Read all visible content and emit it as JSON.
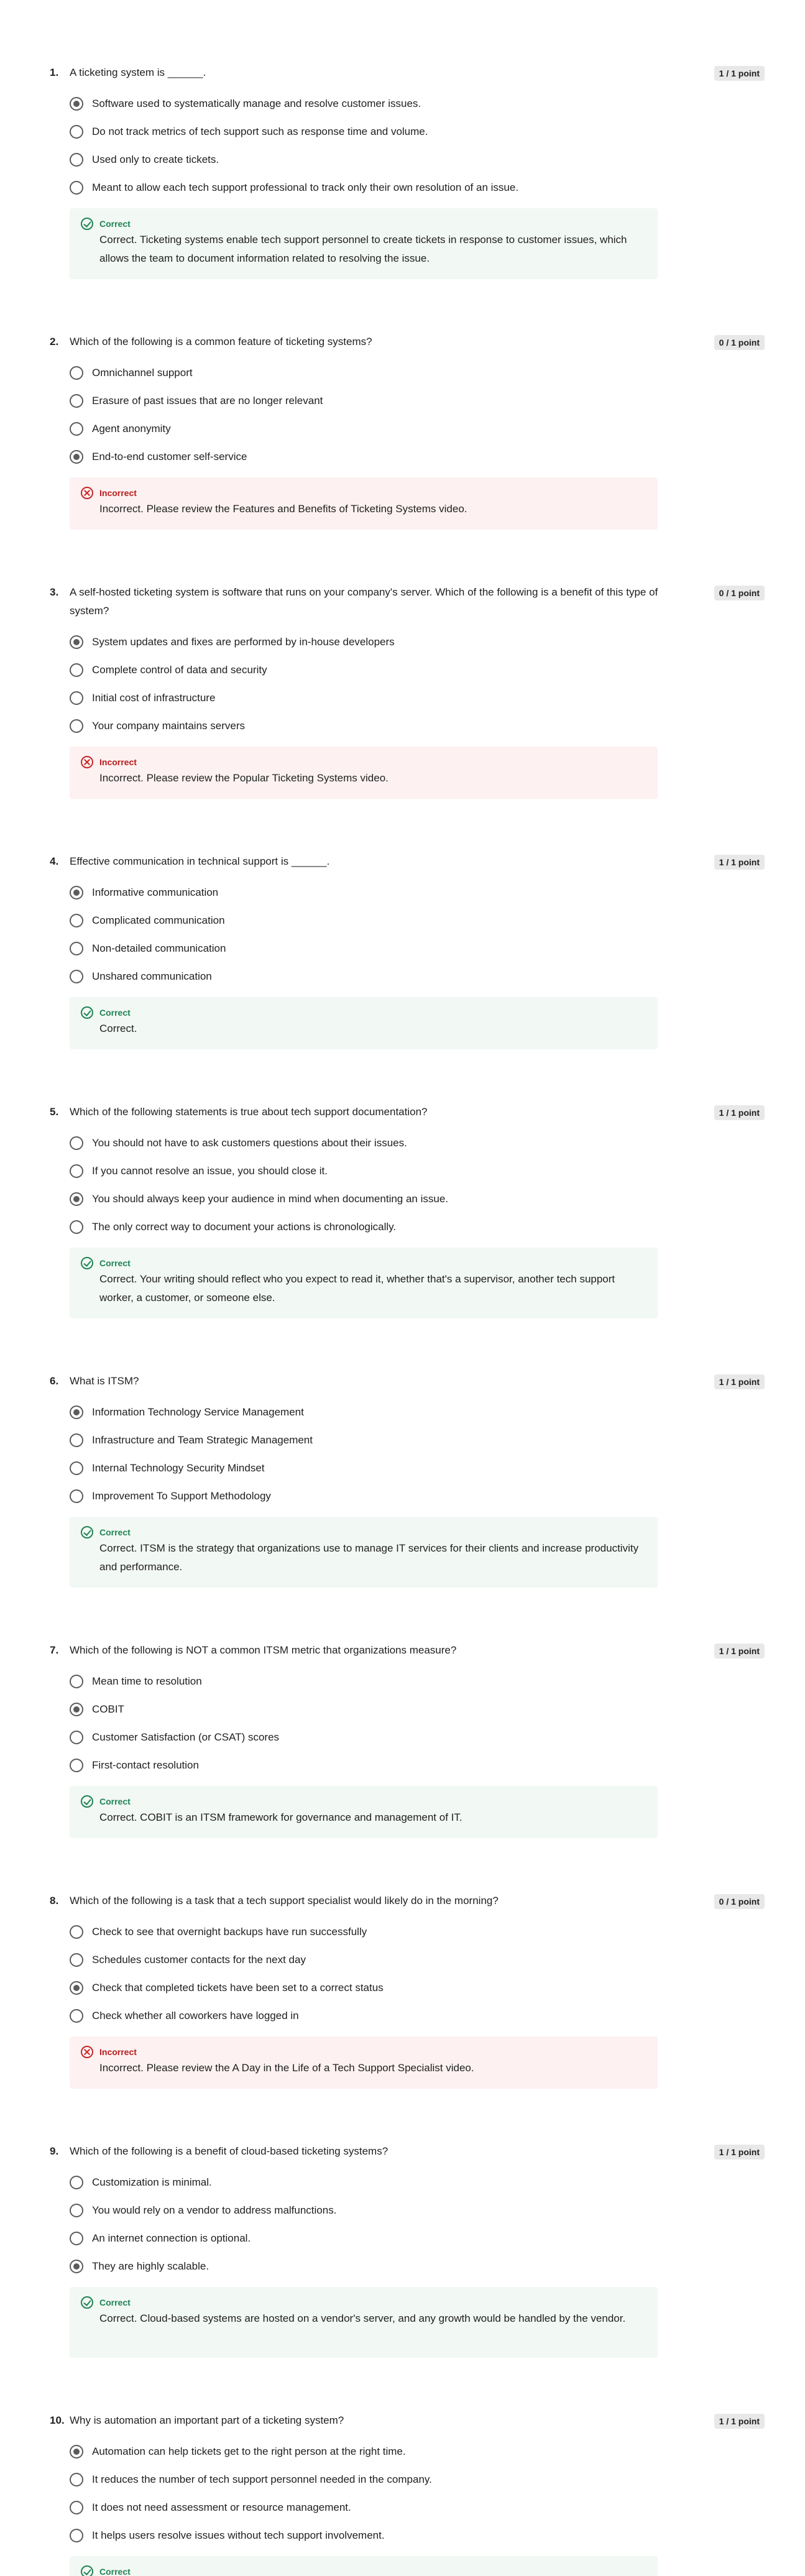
{
  "questions": [
    {
      "number": "1.",
      "text": "A ticketing system is ______.",
      "points": "1 / 1 point",
      "options": [
        "Software used to systematically manage and resolve customer issues.",
        "Do not track metrics of tech support such as response time and volume.",
        "Used only to create tickets.",
        "Meant to allow each tech support professional to track only their own resolution of an issue."
      ],
      "selected": 0,
      "status": "correct",
      "feedback_title": "Correct",
      "feedback_text": "Correct. Ticketing systems enable tech support personnel to create tickets in response to customer issues, which allows the team to document information related to resolving the issue."
    },
    {
      "number": "2.",
      "text": "Which of the following is a common feature of ticketing systems?",
      "points": "0 / 1 point",
      "options": [
        "Omnichannel support",
        "Erasure of past issues that are no longer relevant",
        "Agent anonymity",
        "End-to-end customer self-service"
      ],
      "selected": 3,
      "status": "incorrect",
      "feedback_title": "Incorrect",
      "feedback_text": "Incorrect. Please review the Features and Benefits of Ticketing Systems video."
    },
    {
      "number": "3.",
      "text": "A self-hosted ticketing system is software that runs on your company's server. Which of the following is a benefit of this type of system?",
      "points": "0 / 1 point",
      "options": [
        "System updates and fixes are performed by in-house developers",
        "Complete control of data and security",
        "Initial cost of infrastructure",
        "Your company maintains servers"
      ],
      "selected": 0,
      "status": "incorrect",
      "feedback_title": "Incorrect",
      "feedback_text": "Incorrect. Please review the Popular Ticketing Systems video."
    },
    {
      "number": "4.",
      "text": "Effective communication in technical support is ______.",
      "points": "1 / 1 point",
      "options": [
        "Informative communication",
        "Complicated communication",
        "Non-detailed communication",
        "Unshared communication"
      ],
      "selected": 0,
      "status": "correct",
      "feedback_title": "Correct",
      "feedback_text": "Correct."
    },
    {
      "number": "5.",
      "text": "Which of the following statements is true about tech support documentation?",
      "points": "1 / 1 point",
      "options": [
        "You should not have to ask customers questions about their issues.",
        "If you cannot resolve an issue, you should close it.",
        "You should always keep your audience in mind when documenting an issue.",
        "The only correct way to document your actions is chronologically."
      ],
      "selected": 2,
      "status": "correct",
      "feedback_title": "Correct",
      "feedback_text": "Correct. Your writing should reflect who you expect to read it, whether that's a supervisor, another tech support worker, a customer, or someone else."
    },
    {
      "number": "6.",
      "text": "What is ITSM?",
      "points": "1 / 1 point",
      "options": [
        "Information Technology Service Management",
        "Infrastructure and Team Strategic Management",
        "Internal Technology Security Mindset",
        "Improvement To Support Methodology"
      ],
      "selected": 0,
      "status": "correct",
      "feedback_title": "Correct",
      "feedback_text": "Correct. ITSM is the strategy that organizations use to manage IT services for their clients and increase productivity and performance."
    },
    {
      "number": "7.",
      "text": "Which of the following is NOT a common ITSM metric that organizations measure?",
      "points": "1 / 1 point",
      "options": [
        "Mean time to resolution",
        "COBIT",
        "Customer Satisfaction (or CSAT) scores",
        "First-contact resolution"
      ],
      "selected": 1,
      "status": "correct",
      "feedback_title": "Correct",
      "feedback_text": "Correct. COBIT is an ITSM framework for governance and management of IT."
    },
    {
      "number": "8.",
      "text": "Which of the following is a task that a tech support specialist would likely do in the morning?",
      "points": "0 / 1 point",
      "options": [
        "Check to see that overnight backups have run successfully",
        "Schedules customer contacts for the next day",
        "Check that completed tickets have been set to a correct status",
        "Check whether all coworkers have logged in"
      ],
      "selected": 2,
      "status": "incorrect",
      "feedback_title": "Incorrect",
      "feedback_text": "Incorrect. Please review the A Day in the Life of a Tech Support Specialist video."
    },
    {
      "number": "9.",
      "text": "Which of the following is a benefit of cloud-based ticketing systems?",
      "points": "1 / 1 point",
      "options": [
        "Customization is minimal.",
        "You would rely on a vendor to address malfunctions.",
        "An internet connection is optional.",
        "They are highly scalable."
      ],
      "selected": 3,
      "status": "correct",
      "feedback_title": "Correct",
      "feedback_text": "Correct. Cloud-based systems are hosted on a vendor's server, and any growth would be handled by the vendor."
    },
    {
      "number": "10.",
      "text": "Why is automation an important part of a ticketing system?",
      "points": "1 / 1 point",
      "options": [
        "Automation can help tickets get to the right person at the right time.",
        "It reduces the number of tech support personnel needed in the company.",
        "It does not need assessment or resource management.",
        "It helps users resolve issues without tech support involvement."
      ],
      "selected": 0,
      "status": "correct",
      "feedback_title": "Correct",
      "feedback_text": ""
    }
  ]
}
